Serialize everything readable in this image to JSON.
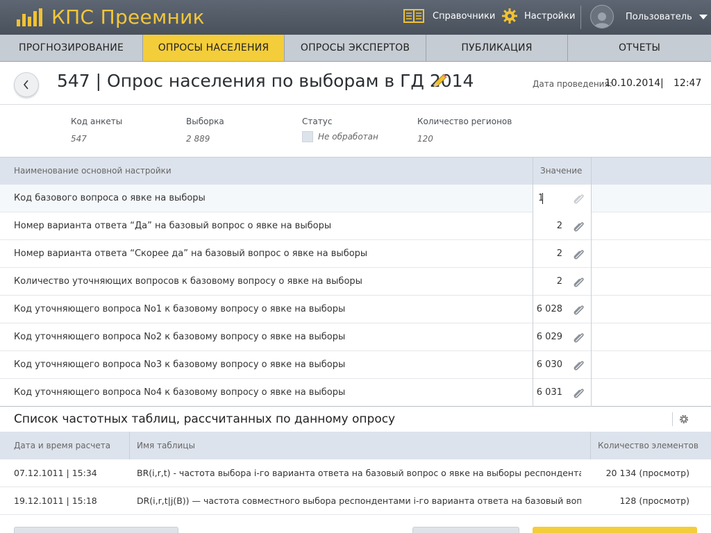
{
  "app": {
    "title": "КПС Преемник"
  },
  "header": {
    "directories_label": "Справочники",
    "settings_label": "Настройки",
    "user_label": "Пользователь"
  },
  "nav": {
    "tabs": [
      {
        "label": "ПРОГНОЗИРОВАНИЕ"
      },
      {
        "label": "ОПРОСЫ НАСЕЛЕНИЯ"
      },
      {
        "label": "ОПРОСЫ ЭКСПЕРТОВ"
      },
      {
        "label": "ПУБЛИКАЦИЯ"
      },
      {
        "label": "ОТЧЕТЫ"
      }
    ],
    "active": "ОПРОСЫ НАСЕЛЕНИЯ"
  },
  "page": {
    "title": "547 | Опрос населения по выборам в ГД 2014",
    "date_label": "Дата проведения:",
    "date": "10.10.2014",
    "date_sep": "|",
    "time": "12:47"
  },
  "meta": {
    "code_label": "Код анкеты",
    "code": "547",
    "sample_label": "Выборка",
    "sample": "2 889",
    "status_label": "Статус",
    "status": "Не обработан",
    "regions_label": "Количество регионов",
    "regions": "120"
  },
  "settings": {
    "col_name": "Наименование основной настройки",
    "col_value": "Значение",
    "rows": [
      {
        "name": "Код базового вопроса о явке на выборы",
        "value": "1"
      },
      {
        "name": "Номер варианта ответа “Да” на базовый вопрос о явке на выборы",
        "value": "2"
      },
      {
        "name": "Номер варианта ответа “Скорее да” на базовый вопрос о явке на выборы",
        "value": "2"
      },
      {
        "name": "Количество уточняющих вопросов к базовому вопросу  о явке на выборы",
        "value": "2"
      },
      {
        "name": "Код уточняющего вопроса No1 к базовому вопросу о явке на выборы",
        "value": "6 028"
      },
      {
        "name": "Код уточняющего вопроса No2 к базовому вопросу о явке на выборы",
        "value": "6 029"
      },
      {
        "name": "Код уточняющего вопроса No3 к базовому вопросу о явке на выборы",
        "value": "6 030"
      },
      {
        "name": "Код уточняющего вопроса No4 к базовому вопросу о явке на выборы",
        "value": "6 031"
      }
    ]
  },
  "freq": {
    "title": "Список частотных таблиц, рассчитанных по данному опросу",
    "col_date": "Дата и время расчета",
    "col_name": "Имя таблицы",
    "col_count": "Количество элементов",
    "rows": [
      {
        "date": "07.12.1011 | 15:34",
        "name": "BR(i,r,t) - частота выбора i-го варианта ответа на базовый вопрос о явке на выборы респондентами, пр…",
        "count": "20 134 (просмотр)"
      },
      {
        "date": "19.12.1011 | 15:18",
        "name": "DR(i,r,t|j(B)) — частота совместного выбора респондентами i-го варианта ответа на базовый вопрос и j-…",
        "count": "128 (просмотр)"
      }
    ]
  },
  "colors": {
    "accent": "#f4cd3a",
    "header_bg": "#525a65",
    "nav_bg": "#c6ccd3",
    "table_head": "#dde3ec"
  }
}
